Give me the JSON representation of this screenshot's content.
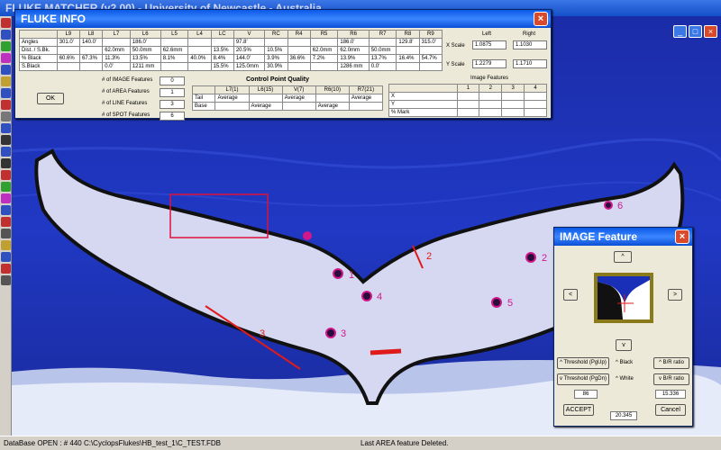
{
  "app": {
    "title": "FLUKE MATCHER  (v2.00)  -  University of Newcastle - Australia"
  },
  "status_bar": {
    "left": "DataBase OPEN  :  #  440  C:\\CyclopsFlukes\\HB_test_1\\C_TEST.FDB",
    "center": "Last AREA feature Deleted."
  },
  "fluke_info": {
    "title": "FLUKE INFO",
    "columns": [
      "",
      "L9",
      "L8",
      "L7",
      "L6",
      "L5",
      "L4",
      "LC",
      "V",
      "RC",
      "R4",
      "R5",
      "R6",
      "R7",
      "R8",
      "R9"
    ],
    "rows": [
      [
        "Angles",
        "301.0'",
        "140.0'",
        "",
        "186.0'",
        "",
        "",
        "",
        "97.8'",
        "",
        "",
        "",
        "186.0'",
        "",
        "129.8'",
        "315.0'"
      ],
      [
        "Dist. / S.Bk.",
        "",
        "",
        "62.0mm",
        "50.0mm",
        "62.6mm",
        "",
        "13.5%",
        "20.5%",
        "10.5%",
        "",
        "62.0mm",
        "62.0mm",
        "50.0mm",
        "",
        ""
      ],
      [
        "% Black",
        "60.6%",
        "67.3%",
        "11.3%",
        "13.5%",
        "8.1%",
        "40.0%",
        "8.4%",
        "144.0'",
        "3.9%",
        "36.6%",
        "7.2%",
        "13.9%",
        "13.7%",
        "16.4%",
        "54.7%"
      ],
      [
        "S.Black",
        "",
        "",
        "0.0'",
        "1211 mm",
        "",
        "",
        "15.5%",
        "125.0mm",
        "30.9%",
        "",
        "",
        "1286 mm",
        "0.0'",
        "",
        ""
      ]
    ],
    "scale": {
      "left_header": "Left",
      "right_header": "Right",
      "x_label": "X Scale",
      "x_left": "1.0875",
      "x_right": "1.1030",
      "y_label": "Y Scale",
      "y_left": "1.2279",
      "y_right": "1.1710"
    },
    "ok_label": "OK",
    "counts": [
      {
        "label": "# of IMAGE Features",
        "value": "0"
      },
      {
        "label": "# of AREA Features",
        "value": "1"
      },
      {
        "label": "# of LINE Features",
        "value": "3"
      },
      {
        "label": "# of SPOT Features",
        "value": "6"
      }
    ],
    "cpq": {
      "title": "Control Point Quality",
      "headers": [
        "",
        "L7(1)",
        "L6(15)",
        "V(7)",
        "R6(10)",
        "R7(21)"
      ],
      "rows": [
        [
          "Tail",
          "Average",
          "",
          "Average",
          "",
          "Average"
        ],
        [
          "Base",
          "",
          "Average",
          "",
          "Average",
          ""
        ]
      ]
    },
    "image_features": {
      "title": "Image Features",
      "headers": [
        "",
        "1",
        "2",
        "3",
        "4"
      ],
      "rows": [
        [
          "X",
          "",
          "",
          "",
          ""
        ],
        [
          "Y",
          "",
          "",
          "",
          ""
        ],
        [
          "% Mark",
          "",
          "",
          "",
          ""
        ]
      ]
    }
  },
  "image_feature": {
    "title": "IMAGE Feature",
    "up": "^",
    "left": "<",
    "right": ">",
    "down": "v",
    "thr_up_label": "^ Threshold (PgUp)",
    "thr_down_label": "v Threshold (PgDn)",
    "black_label": "^ Black",
    "white_label": "^ White",
    "br_up_label": "^ B/R ratio",
    "br_down_label": "v B/R ratio",
    "threshold_value": "86",
    "ratio_value": "15.336",
    "accept_label": "ACCEPT",
    "value_readout": "20.345",
    "cancel_label": "Cancel"
  },
  "annotations": {
    "spot_1": "1",
    "spot_2": "2",
    "spot_3": "3",
    "spot_4": "4",
    "spot_5": "5",
    "spot_6": "6",
    "line_2": "2",
    "line_3": "3"
  },
  "colors": {
    "ocean": "#1a2fb8",
    "fluke": "#d9dcf2",
    "title_blue": "#0a58e6",
    "marker_red": "#ff1a1a",
    "spot": "#d0188a"
  }
}
